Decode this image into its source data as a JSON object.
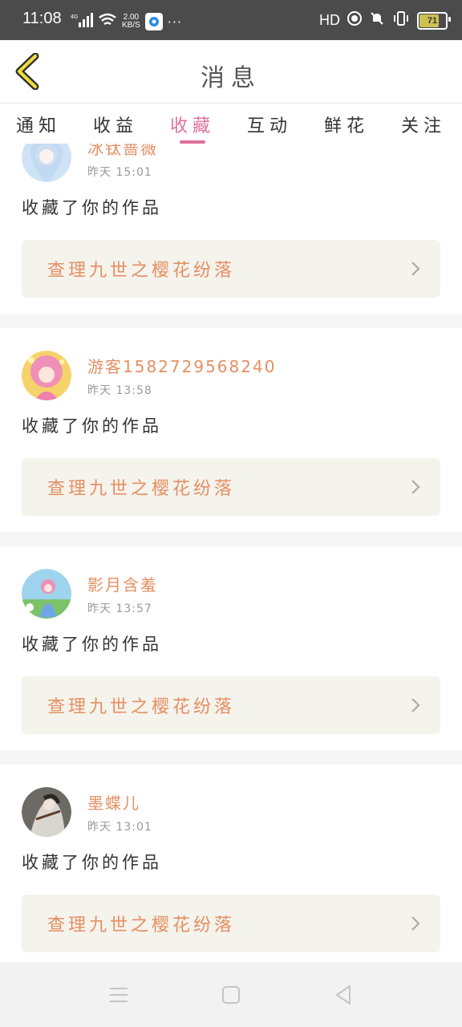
{
  "status_bar": {
    "time": "11:08",
    "network": "4G",
    "speed_value": "2.00",
    "speed_unit": "KB/S",
    "more": "···",
    "hd": "HD",
    "battery": "71"
  },
  "header": {
    "title": "消息"
  },
  "tabs": [
    {
      "label": "通知",
      "active": false
    },
    {
      "label": "收益",
      "active": false
    },
    {
      "label": "收藏",
      "active": true
    },
    {
      "label": "互动",
      "active": false
    },
    {
      "label": "鲜花",
      "active": false
    },
    {
      "label": "关注",
      "active": false
    }
  ],
  "messages": [
    {
      "name": "冰钛蔷薇",
      "time": "昨天 15:01",
      "text": "收藏了你的作品",
      "work": "查理九世之樱花纷落"
    },
    {
      "name": "游客15827295682​40",
      "time": "昨天 13:58",
      "text": "收藏了你的作品",
      "work": "查理九世之樱花纷落"
    },
    {
      "name": "影月含羞",
      "time": "昨天 13:57",
      "text": "收藏了你的作品",
      "work": "查理九世之樱花纷落"
    },
    {
      "name": "墨蝶儿",
      "time": "昨天 13:01",
      "text": "收藏了你的作品",
      "work": "查理九世之樱花纷落"
    }
  ],
  "colors": {
    "accent": "#e0709c",
    "name": "#e58f63",
    "worklink_bg": "#f4f3ec"
  }
}
